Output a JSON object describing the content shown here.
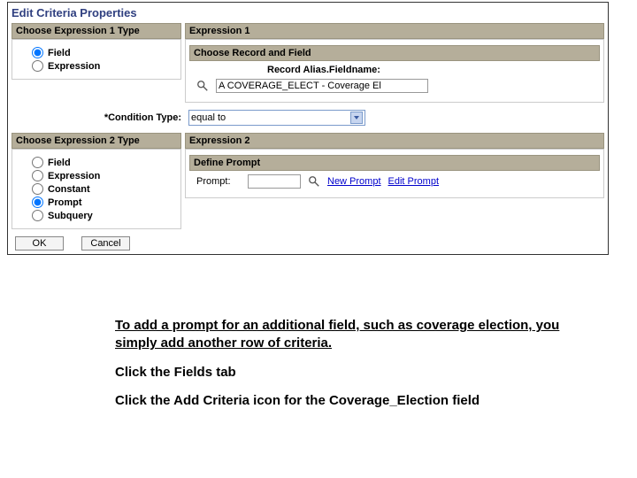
{
  "title": "Edit Criteria Properties",
  "expr1type": {
    "header": "Choose Expression 1 Type",
    "opt_field": "Field",
    "opt_expr": "Expression"
  },
  "expr1": {
    "header": "Expression 1",
    "sub_header": "Choose Record and Field",
    "label": "Record Alias.Fieldname:",
    "value": "A COVERAGE_ELECT - Coverage El"
  },
  "condition": {
    "label": "*Condition Type:",
    "value": "equal to"
  },
  "expr2type": {
    "header": "Choose Expression 2 Type",
    "opt_field": "Field",
    "opt_expr": "Expression",
    "opt_const": "Constant",
    "opt_prompt": "Prompt",
    "opt_sub": "Subquery"
  },
  "expr2": {
    "header": "Expression 2",
    "sub_header": "Define Prompt",
    "label": "Prompt:",
    "new_link": "New Prompt",
    "edit_link": "Edit Prompt"
  },
  "buttons": {
    "ok": "OK",
    "cancel": "Cancel"
  },
  "instructions": {
    "line1": "To add a prompt for an additional field, such as coverage election, you simply add another row of criteria.",
    "line2": "Click the Fields tab",
    "line3": "Click the Add Criteria icon for the Coverage_Election field"
  }
}
